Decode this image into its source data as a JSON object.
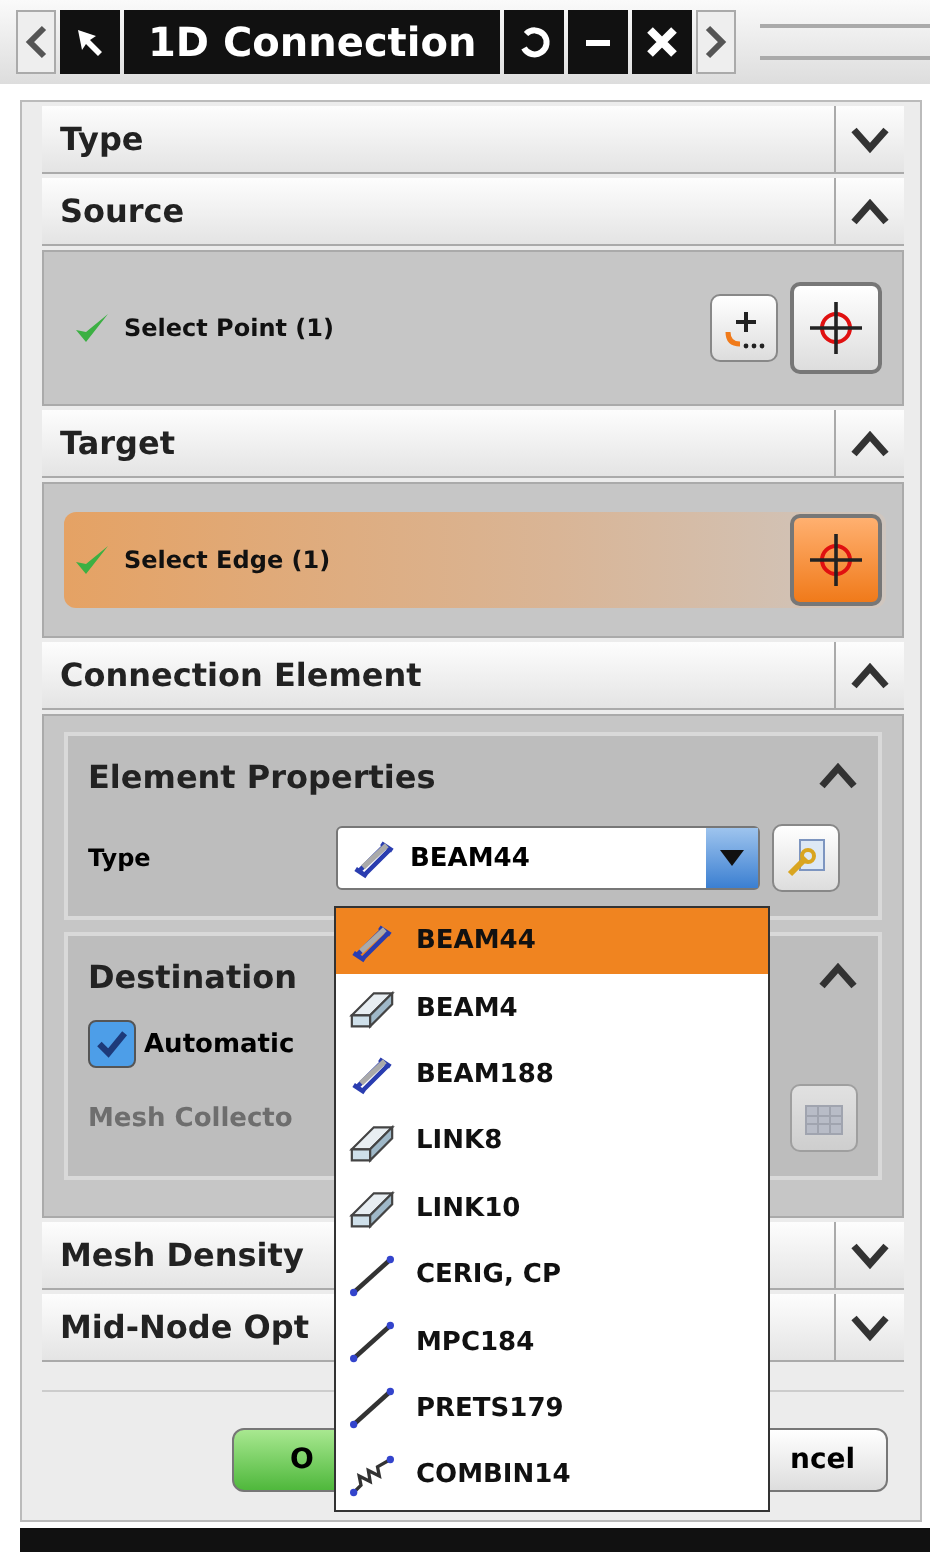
{
  "window": {
    "title": "1D Connection"
  },
  "sections": [
    {
      "title": "Type",
      "expanded": false
    },
    {
      "title": "Source",
      "expanded": true,
      "kind": "selection",
      "selection": {
        "label": "Select Point (1)",
        "done": true,
        "active": false,
        "point_dialog": true
      }
    },
    {
      "title": "Target",
      "expanded": true,
      "kind": "selection",
      "selection": {
        "label": "Select Edge (1)",
        "done": true,
        "active": true,
        "point_dialog": false
      }
    },
    {
      "title": "Connection Element",
      "expanded": true,
      "kind": "element",
      "subpanels": [
        {
          "title": "Element Properties",
          "expanded": true,
          "kind": "type",
          "label": "Type",
          "value": "BEAM44"
        },
        {
          "title": "Destination",
          "expanded": true,
          "kind": "destination",
          "checkbox": {
            "label": "Automatic",
            "checked": true
          },
          "field_label": "Mesh Collecto",
          "disabled": true
        }
      ]
    },
    {
      "title": "Mesh Density",
      "expanded": false
    },
    {
      "title": "Mid-Node Opt",
      "expanded": false
    }
  ],
  "dropdown": {
    "items": [
      {
        "label": "BEAM44",
        "kind": "ibeam",
        "selected": true
      },
      {
        "label": "BEAM4",
        "kind": "block",
        "selected": false
      },
      {
        "label": "BEAM188",
        "kind": "ibeam",
        "selected": false
      },
      {
        "label": "LINK8",
        "kind": "block",
        "selected": false
      },
      {
        "label": "LINK10",
        "kind": "block",
        "selected": false
      },
      {
        "label": "CERIG, CP",
        "kind": "line",
        "selected": false
      },
      {
        "label": "MPC184",
        "kind": "line",
        "selected": false
      },
      {
        "label": "PRETS179",
        "kind": "line",
        "selected": false
      },
      {
        "label": "COMBIN14",
        "kind": "spring",
        "selected": false
      }
    ]
  },
  "buttons": [
    {
      "label": "O",
      "kind": "ok"
    },
    {
      "label": "ncel",
      "kind": "cancel"
    }
  ]
}
